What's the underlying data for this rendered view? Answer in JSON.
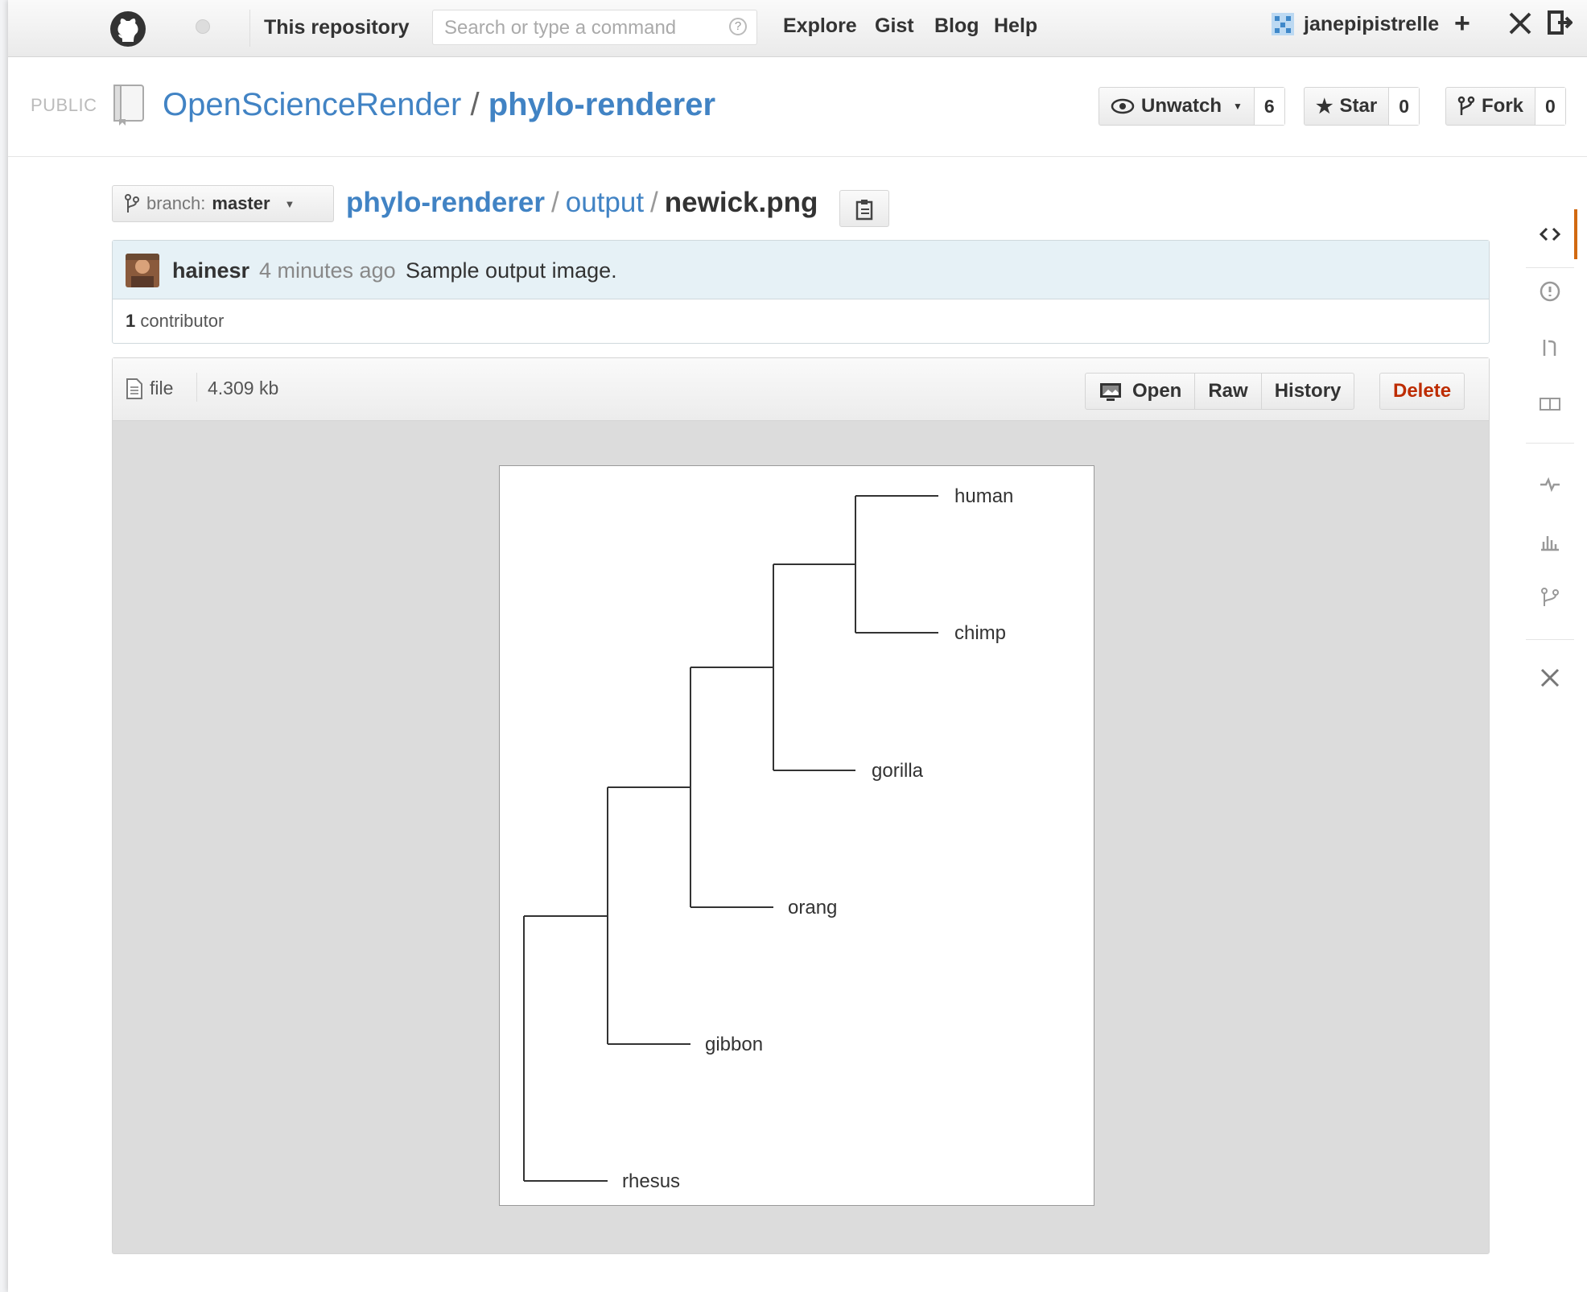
{
  "topbar": {
    "scope_label": "This repository",
    "search_placeholder": "Search or type a command",
    "help_label": "?",
    "nav": [
      "Explore",
      "Gist",
      "Blog",
      "Help"
    ],
    "username": "janepipistrelle",
    "plus_label": "+"
  },
  "repo": {
    "visibility": "PUBLIC",
    "owner": "OpenScienceRender",
    "slash": "/",
    "name": "phylo-renderer",
    "unwatch_label": "Unwatch",
    "watch_count": "6",
    "star_label": "Star",
    "star_count": "0",
    "fork_label": "Fork",
    "fork_count": "0"
  },
  "file_nav": {
    "branch_label": "branch:",
    "branch_value": "master",
    "path_root": "phylo-renderer",
    "path_dir": "output",
    "path_file": "newick.png",
    "separator": "/"
  },
  "commit": {
    "author": "hainesr",
    "time": "4 minutes ago",
    "message": "Sample output image.",
    "contributor_count": "1",
    "contributor_label": "contributor"
  },
  "file": {
    "type_label": "file",
    "size": "4.309 kb",
    "actions": {
      "open": "Open",
      "raw": "Raw",
      "history": "History",
      "delete": "Delete"
    }
  },
  "tree_image": {
    "taxa": [
      "human",
      "chimp",
      "gorilla",
      "orang",
      "gibbon",
      "rhesus"
    ]
  },
  "colors": {
    "link": "#4183c4",
    "delete": "#bd2c00",
    "commit_bg": "#e6f1f6",
    "file_bg": "#dcdcdc",
    "active_tab": "#d26911"
  }
}
